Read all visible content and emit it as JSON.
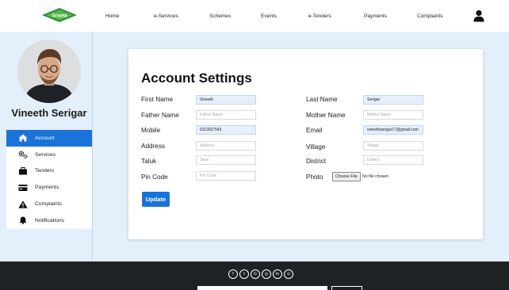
{
  "brand": {
    "logo_text": "Grama"
  },
  "nav": {
    "items": [
      {
        "label": "Home"
      },
      {
        "label": "e-Services"
      },
      {
        "label": "Schemes"
      },
      {
        "label": "Events"
      },
      {
        "label": "e-Tenders"
      },
      {
        "label": "Payments"
      },
      {
        "label": "Complaints"
      }
    ],
    "user_icon": "user-icon"
  },
  "profile": {
    "name": "Vineeth Serigar"
  },
  "sidebar": {
    "items": [
      {
        "label": "Account",
        "icon": "home-icon",
        "active": true
      },
      {
        "label": "Services",
        "icon": "gears-icon"
      },
      {
        "label": "Tenders",
        "icon": "briefcase-icon"
      },
      {
        "label": "Payments",
        "icon": "card-icon"
      },
      {
        "label": "Complaints",
        "icon": "warning-icon"
      },
      {
        "label": "Notifications",
        "icon": "bell-icon"
      }
    ]
  },
  "form": {
    "title": "Account Settings",
    "first_name": {
      "label": "First Name",
      "value": "Vineeth",
      "placeholder": ""
    },
    "last_name": {
      "label": "Last Name",
      "value": "Serigar",
      "placeholder": ""
    },
    "father_name": {
      "label": "Father Name",
      "value": "",
      "placeholder": "Father Name"
    },
    "mother_name": {
      "label": "Mother Name",
      "value": "",
      "placeholder": "Mother Name"
    },
    "mobile": {
      "label": "Mobile",
      "value": "9113937543",
      "placeholder": ""
    },
    "email": {
      "label": "Email",
      "value": "vineethserigar17@gmail.com",
      "placeholder": ""
    },
    "address": {
      "label": "Address",
      "value": "",
      "placeholder": "Address"
    },
    "village": {
      "label": "Village",
      "value": "",
      "placeholder": "Village"
    },
    "taluk": {
      "label": "Taluk",
      "value": "",
      "placeholder": "Taluk"
    },
    "district": {
      "label": "District",
      "value": "",
      "placeholder": "District"
    },
    "pin_code": {
      "label": "Pin Code",
      "value": "",
      "placeholder": "Pin Code"
    },
    "photo": {
      "label": "Photo",
      "button_label": "Choose File",
      "status": "No file chosen"
    },
    "update_label": "Update"
  },
  "footer": {
    "social": [
      {
        "icon": "facebook-icon",
        "glyph": "f"
      },
      {
        "icon": "twitter-icon",
        "glyph": "t"
      },
      {
        "icon": "google-icon",
        "glyph": "G"
      },
      {
        "icon": "instagram-icon",
        "glyph": "◎"
      },
      {
        "icon": "linkedin-icon",
        "glyph": "in"
      },
      {
        "icon": "github-icon",
        "glyph": "⊙"
      }
    ]
  },
  "colors": {
    "accent": "#1a73d9",
    "page_bg": "#e3effa",
    "footer_bg": "#1f2225",
    "logo_green": "#2f8f3a"
  }
}
